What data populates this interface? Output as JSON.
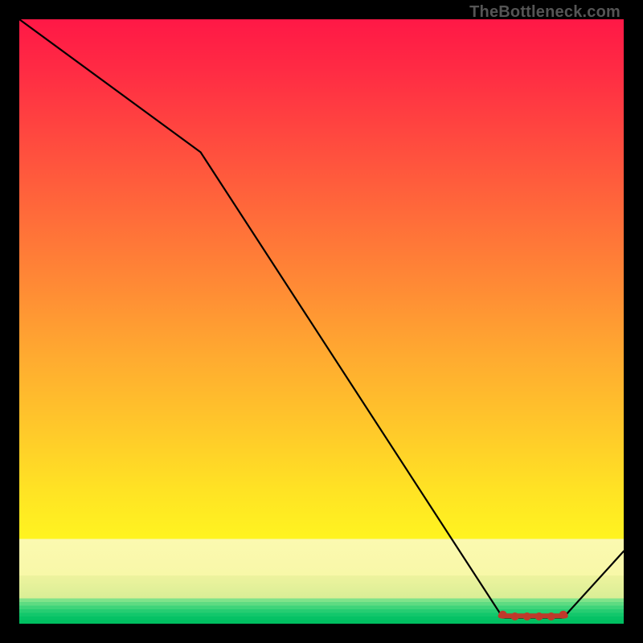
{
  "attribution": "TheBottleneck.com",
  "chart_data": {
    "type": "line",
    "title": "",
    "xlabel": "",
    "ylabel": "",
    "xlim": [
      0,
      100
    ],
    "ylim": [
      0,
      100
    ],
    "grid": false,
    "legend": false,
    "series": [
      {
        "name": "curve",
        "x": [
          0,
          30,
          80,
          90,
          100
        ],
        "y": [
          100,
          78,
          1,
          1,
          12
        ],
        "stroke": "#000000"
      }
    ],
    "markers": {
      "name": "bottom-dots",
      "x": [
        80,
        82,
        84,
        86,
        88,
        90
      ],
      "y": [
        1.5,
        1.2,
        1.2,
        1.2,
        1.2,
        1.5
      ],
      "fill": "#c0392b",
      "radius": 5
    },
    "background": {
      "type": "vertical-gradient",
      "stops": [
        {
          "pct": 0,
          "color": "#ff1846"
        },
        {
          "pct": 50,
          "color": "#ff9a33"
        },
        {
          "pct": 82,
          "color": "#ffe324"
        },
        {
          "pct": 90,
          "color": "#f9f8aa"
        },
        {
          "pct": 100,
          "color": "#00bf60"
        }
      ]
    }
  }
}
